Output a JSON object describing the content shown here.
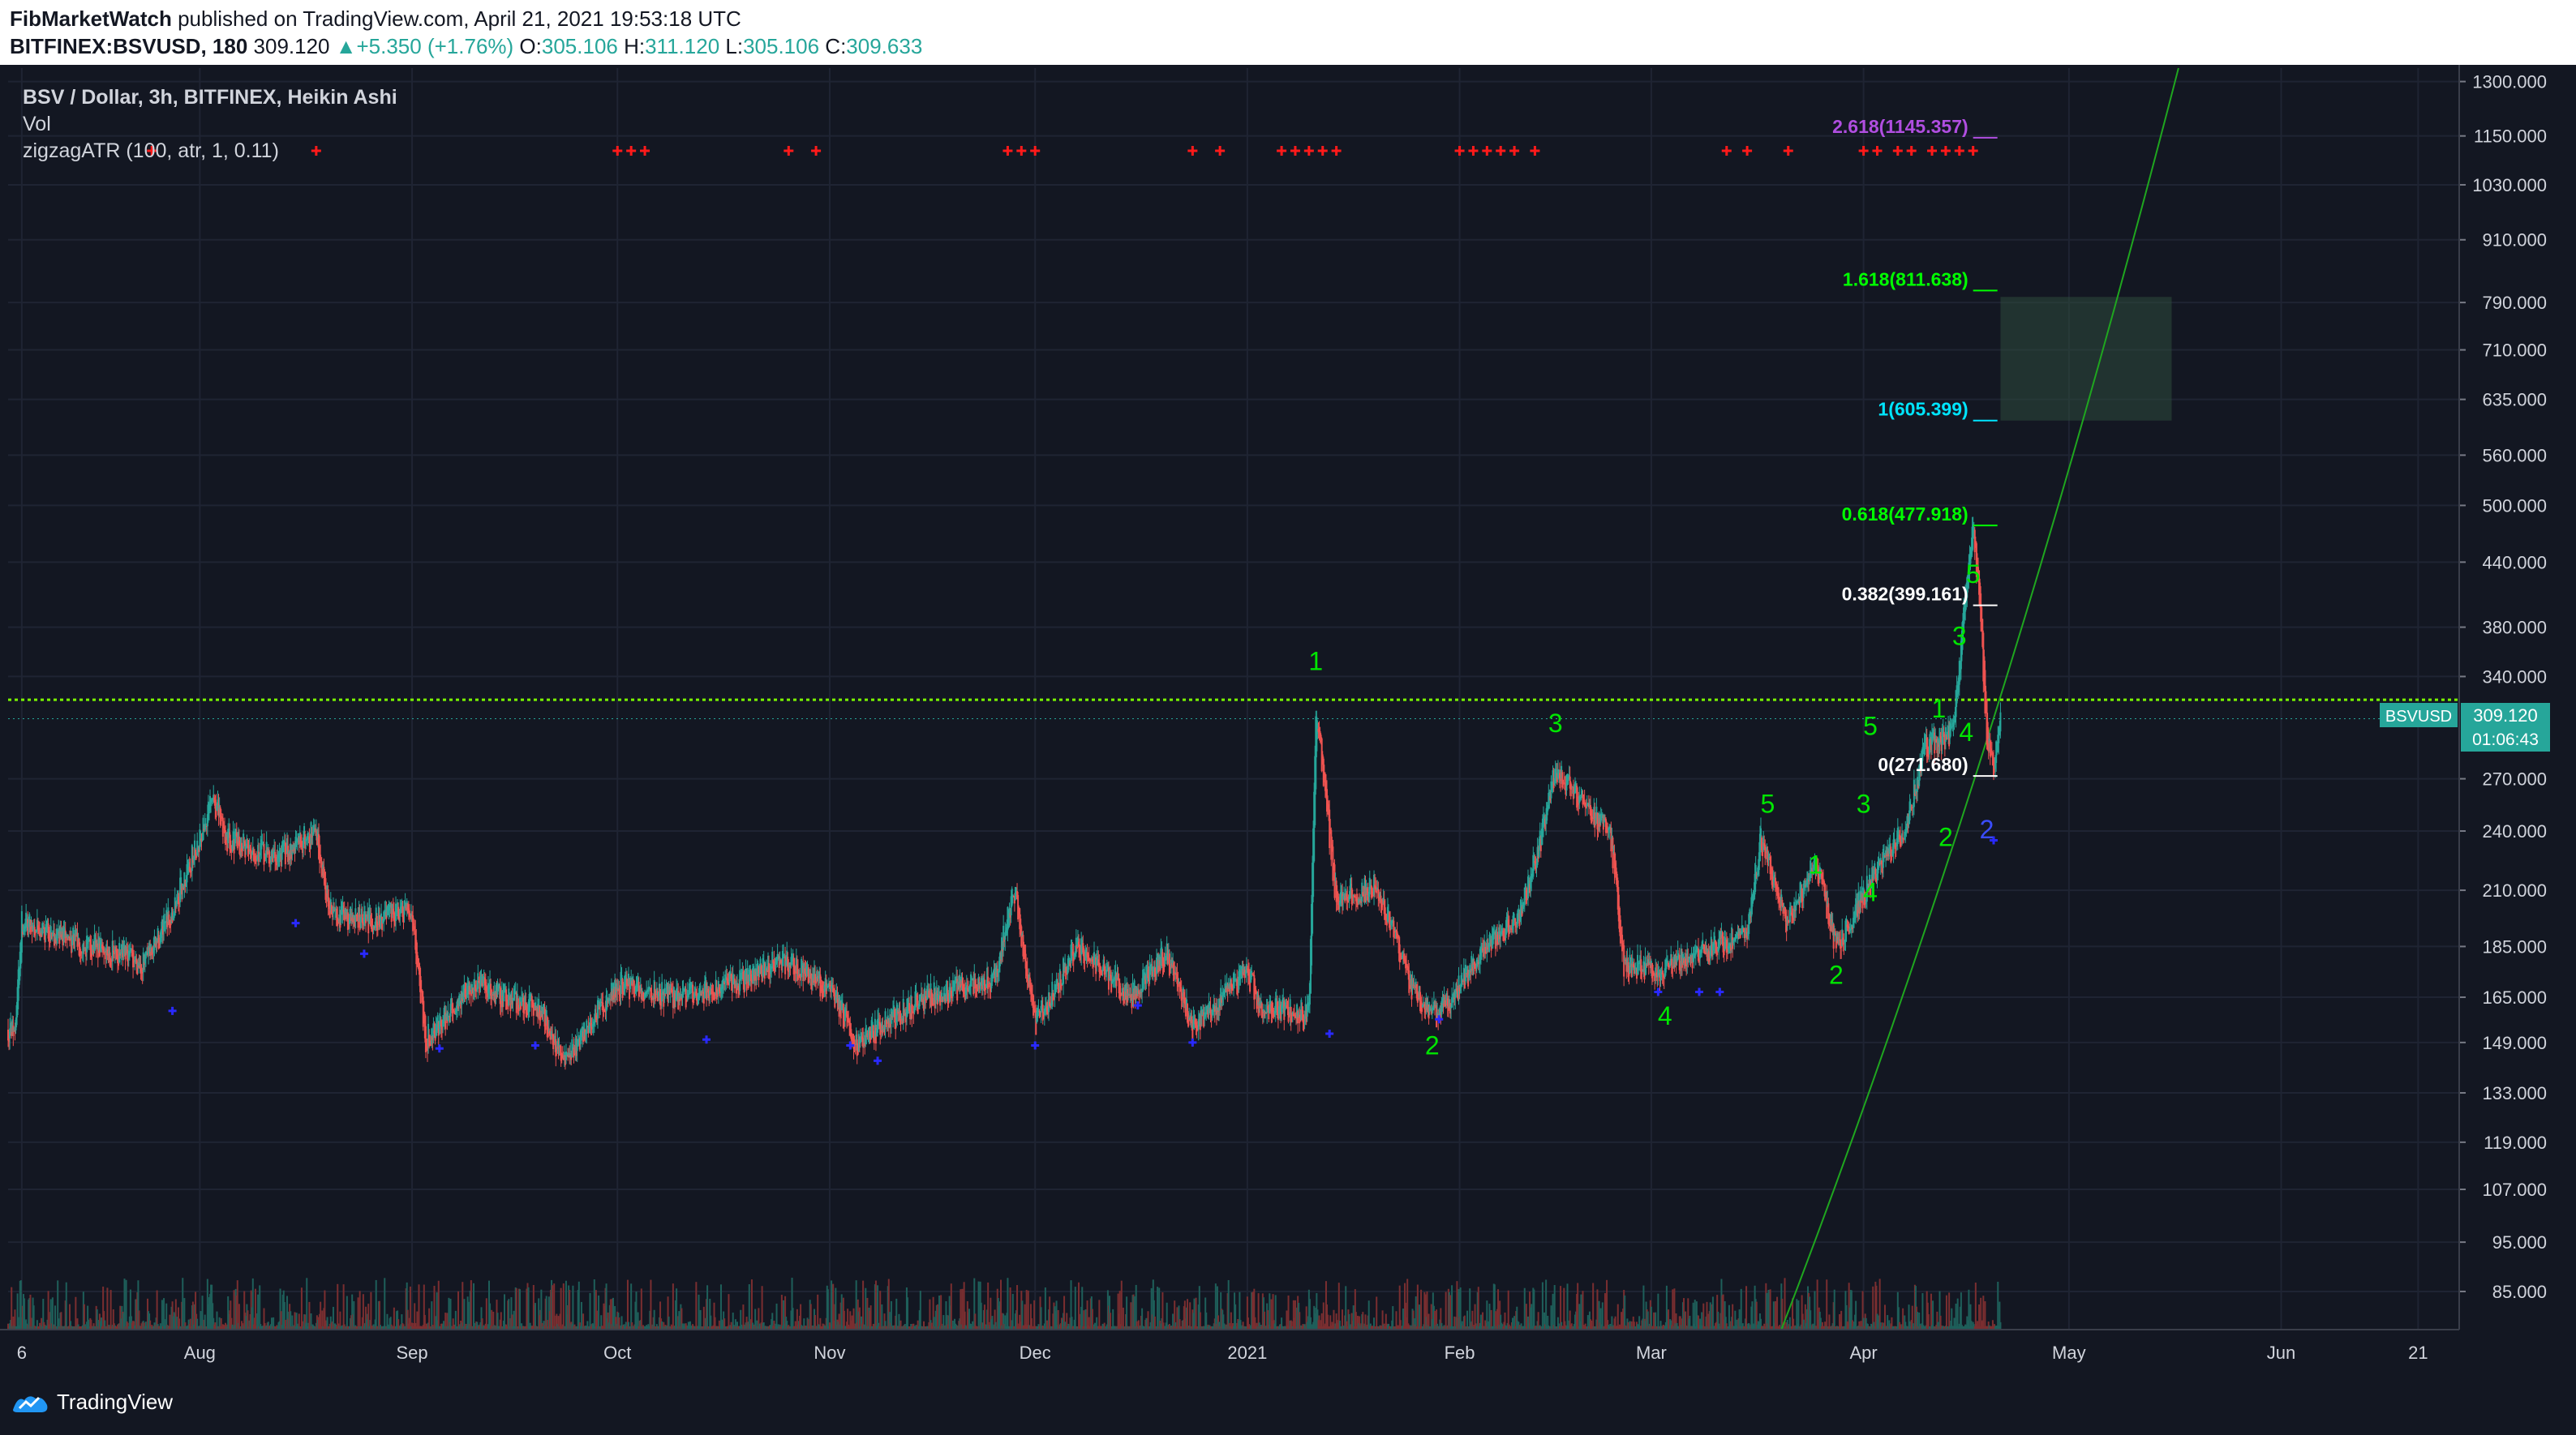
{
  "header": {
    "author": "FibMarketWatch",
    "published_text": "published on TradingView.com, April 21, 2021 19:53:18 UTC",
    "symbol": "BITFINEX:BSVUSD, 180",
    "last_price": "309.120",
    "change": "+5.350 (+1.76%)",
    "o_label": "O:",
    "o_value": "305.106",
    "h_label": "H:",
    "h_value": "311.120",
    "l_label": "L:",
    "l_value": "305.106",
    "c_label": "C:",
    "c_value": "309.633"
  },
  "legend": {
    "title": "BSV / Dollar, 3h, BITFINEX, Heikin Ashi",
    "vol": "Vol",
    "indicator": "zigzagATR (100, atr, 1, 0.11)"
  },
  "price_badge": {
    "symbol": "BSVUSD",
    "price": "309.120",
    "countdown": "01:06:43"
  },
  "brand": {
    "name": "TradingView"
  },
  "colors": {
    "background": "#131722",
    "candle_up": "#26a69a",
    "candle_down": "#ef5350",
    "wave_labels": "#00e600",
    "zigzag_marks": "#ff1a1a",
    "pivot_marks": "#2929ff",
    "price_line": "#7cfc00"
  },
  "chart_data": {
    "type": "candlestick",
    "series_type": "Heikin Ashi",
    "scale": "log",
    "ylim": [
      78,
      1340
    ],
    "y_ticks": [
      "1300.000",
      "1150.000",
      "1030.000",
      "910.000",
      "790.000",
      "710.000",
      "635.000",
      "560.000",
      "500.000",
      "440.000",
      "380.000",
      "340.000",
      "270.000",
      "240.000",
      "210.000",
      "185.000",
      "165.000",
      "149.000",
      "133.000",
      "119.000",
      "107.000",
      "95.000",
      "85.000"
    ],
    "x_range": [
      "2020-07-04",
      "2021-06-27"
    ],
    "x_ticks": [
      {
        "label": "6",
        "date": "2020-07-06"
      },
      {
        "label": "Aug",
        "date": "2020-08-01"
      },
      {
        "label": "Sep",
        "date": "2020-09-01"
      },
      {
        "label": "Oct",
        "date": "2020-10-01"
      },
      {
        "label": "Nov",
        "date": "2020-11-01"
      },
      {
        "label": "Dec",
        "date": "2020-12-01"
      },
      {
        "label": "2021",
        "date": "2021-01-01"
      },
      {
        "label": "Feb",
        "date": "2021-02-01"
      },
      {
        "label": "Mar",
        "date": "2021-03-01"
      },
      {
        "label": "Apr",
        "date": "2021-04-01"
      },
      {
        "label": "May",
        "date": "2021-05-01"
      },
      {
        "label": "Jun",
        "date": "2021-06-01"
      },
      {
        "label": "21",
        "date": "2021-06-21"
      }
    ],
    "price_path": [
      [
        "2020-07-01",
        158
      ],
      [
        "2020-07-05",
        152
      ],
      [
        "2020-07-06",
        196
      ],
      [
        "2020-07-15",
        186
      ],
      [
        "2020-07-24",
        178
      ],
      [
        "2020-07-28",
        200
      ],
      [
        "2020-08-03",
        258
      ],
      [
        "2020-08-05",
        236
      ],
      [
        "2020-08-12",
        226
      ],
      [
        "2020-08-18",
        240
      ],
      [
        "2020-08-20",
        200
      ],
      [
        "2020-08-25",
        196
      ],
      [
        "2020-09-01",
        200
      ],
      [
        "2020-09-03",
        150
      ],
      [
        "2020-09-10",
        170
      ],
      [
        "2020-09-20",
        160
      ],
      [
        "2020-09-23",
        142
      ],
      [
        "2020-10-01",
        170
      ],
      [
        "2020-10-10",
        165
      ],
      [
        "2020-10-20",
        172
      ],
      [
        "2020-10-25",
        180
      ],
      [
        "2020-11-01",
        168
      ],
      [
        "2020-11-05",
        149
      ],
      [
        "2020-11-15",
        165
      ],
      [
        "2020-11-25",
        172
      ],
      [
        "2020-11-28",
        210
      ],
      [
        "2020-12-01",
        155
      ],
      [
        "2020-12-07",
        185
      ],
      [
        "2020-12-15",
        165
      ],
      [
        "2020-12-20",
        183
      ],
      [
        "2020-12-24",
        155
      ],
      [
        "2021-01-01",
        175
      ],
      [
        "2021-01-03",
        160
      ],
      [
        "2021-01-10",
        160
      ],
      [
        "2021-01-11",
        318
      ],
      [
        "2021-01-14",
        205
      ],
      [
        "2021-01-20",
        212
      ],
      [
        "2021-01-25",
        168
      ],
      [
        "2021-01-29",
        158
      ],
      [
        "2021-02-05",
        185
      ],
      [
        "2021-02-10",
        200
      ],
      [
        "2021-02-13",
        238
      ],
      [
        "2021-02-15",
        275
      ],
      [
        "2021-02-20",
        250
      ],
      [
        "2021-02-23",
        240
      ],
      [
        "2021-02-25",
        178
      ],
      [
        "2021-03-02",
        176
      ],
      [
        "2021-03-10",
        185
      ],
      [
        "2021-03-15",
        190
      ],
      [
        "2021-03-17",
        235
      ],
      [
        "2021-03-21",
        195
      ],
      [
        "2021-03-25",
        225
      ],
      [
        "2021-03-28",
        185
      ],
      [
        "2021-04-03",
        220
      ],
      [
        "2021-04-07",
        240
      ],
      [
        "2021-04-10",
        290
      ],
      [
        "2021-04-14",
        300
      ],
      [
        "2021-04-15",
        350
      ],
      [
        "2021-04-16",
        420
      ],
      [
        "2021-04-17",
        478
      ],
      [
        "2021-04-18",
        400
      ],
      [
        "2021-04-19",
        300
      ],
      [
        "2021-04-20",
        272
      ],
      [
        "2021-04-21",
        309
      ]
    ],
    "horizontal_line": 322.6,
    "fib_levels": [
      {
        "label": "2.618(1145.357)",
        "value": 1145.357,
        "color": "#b04ee0"
      },
      {
        "label": "1.618(811.638)",
        "value": 811.638,
        "color": "#00ff00"
      },
      {
        "label": "1(605.399)",
        "value": 605.399,
        "color": "#00e5ff"
      },
      {
        "label": "0.618(477.918)",
        "value": 477.918,
        "color": "#00ff00"
      },
      {
        "label": "0.382(399.161)",
        "value": 399.161,
        "color": "#ffffff"
      },
      {
        "label": "0(271.680)",
        "value": 271.68,
        "color": "#ffffff"
      }
    ],
    "target_box": {
      "from": "2021-04-21",
      "to": "2021-05-16",
      "low": 605.399,
      "high": 800
    },
    "wave_labels": [
      {
        "label": "1",
        "date": "2021-01-11",
        "price": 345
      },
      {
        "label": "2",
        "date": "2021-01-28",
        "price": 145
      },
      {
        "label": "3",
        "date": "2021-02-15",
        "price": 300
      },
      {
        "label": "4",
        "date": "2021-03-03",
        "price": 155
      },
      {
        "label": "5",
        "date": "2021-03-18",
        "price": 250
      },
      {
        "label": "1",
        "date": "2021-03-25",
        "price": 218
      },
      {
        "label": "2",
        "date": "2021-03-28",
        "price": 170
      },
      {
        "label": "3",
        "date": "2021-04-01",
        "price": 250
      },
      {
        "label": "4",
        "date": "2021-04-02",
        "price": 205
      },
      {
        "label": "5",
        "date": "2021-04-02",
        "price": 298
      },
      {
        "label": "1",
        "date": "2021-04-12",
        "price": 310
      },
      {
        "label": "2",
        "date": "2021-04-13",
        "price": 232
      },
      {
        "label": "3",
        "date": "2021-04-15",
        "price": 365
      },
      {
        "label": "4",
        "date": "2021-04-16",
        "price": 294
      },
      {
        "label": "5",
        "date": "2021-04-17",
        "price": 420
      },
      {
        "label": "2",
        "date": "2021-04-19",
        "price": 236
      }
    ],
    "curve_line": {
      "from": [
        "2021-03-20",
        78
      ],
      "to": [
        "2021-05-17",
        1340
      ]
    },
    "current_price": 309.12
  }
}
